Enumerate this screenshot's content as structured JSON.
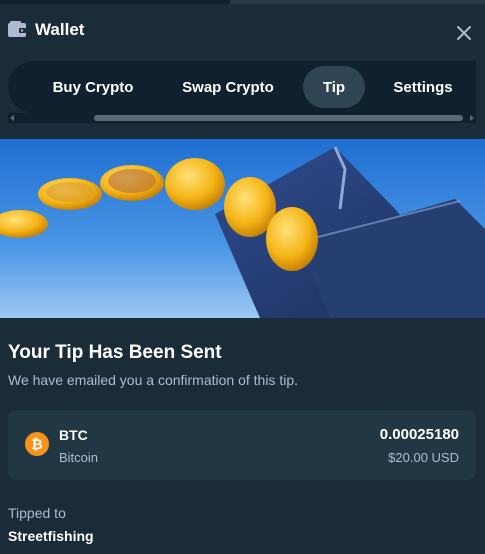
{
  "header": {
    "title": "Wallet",
    "icon": "wallet-icon",
    "close_icon": "close-icon"
  },
  "tabs": [
    {
      "label": "Buy Crypto",
      "active": false
    },
    {
      "label": "Swap Crypto",
      "active": false
    },
    {
      "label": "Tip",
      "active": true
    },
    {
      "label": "Settings",
      "active": false
    }
  ],
  "confirmation": {
    "heading": "Your Tip Has Been Sent",
    "subtext": "We have emailed you a confirmation of this tip."
  },
  "transaction": {
    "currency_code": "BTC",
    "currency_name": "Bitcoin",
    "amount": "0.00025180",
    "fiat_amount": "$20.00 USD",
    "icon": "bitcoin-icon"
  },
  "recipient": {
    "label": "Tipped to",
    "username": "Streetfishing"
  },
  "colors": {
    "background": "#1a2c38",
    "tab_bar": "#0f212e",
    "active_tab": "#2f4553",
    "card": "#213743",
    "muted_text": "#b1bad3",
    "bitcoin": "#f7931a",
    "banner_sky": "#2f7bd6",
    "coin_gold": "#f5b517"
  }
}
